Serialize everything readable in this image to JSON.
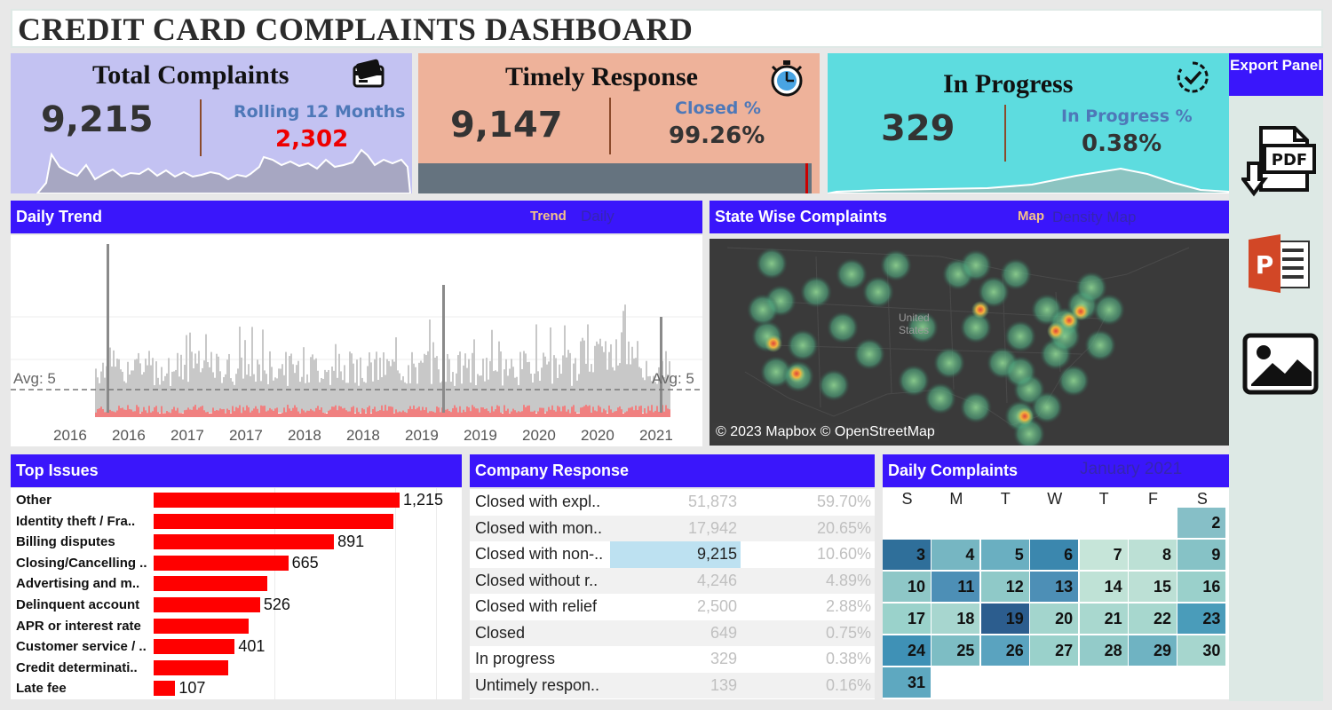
{
  "dashboard_title": "CREDIT CARD COMPLAINTS DASHBOARD",
  "kpi": {
    "total": {
      "title": "Total Complaints",
      "value": "9,215",
      "sub_label": "Rolling 12 Months",
      "sub_value": "2,302",
      "icon": "credit-card-icon"
    },
    "timely": {
      "title": "Timely Response",
      "value": "9,147",
      "sub_label": "Closed %",
      "sub_value": "99.26%",
      "icon": "stopwatch-icon",
      "progress": 0.9926
    },
    "progress": {
      "title": "In Progress",
      "value": "329",
      "sub_label": "In Progress %",
      "sub_value": "0.38%",
      "icon": "check-circle-icon"
    }
  },
  "export": {
    "label": "Export Panel",
    "items": [
      "pdf-icon",
      "powerpoint-icon",
      "image-icon"
    ]
  },
  "daily_trend": {
    "title": "Daily Trend",
    "toggle_active": "Trend",
    "toggle_inactive": "Daily",
    "avg_label_left": "Avg: 5",
    "avg_label_right": "Avg: 5",
    "x_ticks": [
      "2016",
      "2016",
      "2017",
      "2017",
      "2018",
      "2018",
      "2019",
      "2019",
      "2020",
      "2020",
      "2021"
    ]
  },
  "state_map": {
    "title": "State Wise Complaints",
    "toggle_active": "Map",
    "toggle_inactive": "Density Map",
    "map_label_line1": "United",
    "map_label_line2": "States",
    "attribution": "© 2023 Mapbox © OpenStreetMap"
  },
  "top_issues": {
    "title": "Top Issues",
    "items": [
      {
        "label": "Other",
        "value": 1215,
        "display": "1,215"
      },
      {
        "label": "Identity theft / Fra..",
        "value": 1185,
        "display": ""
      },
      {
        "label": "Billing disputes",
        "value": 891,
        "display": "891"
      },
      {
        "label": "Closing/Cancelling ..",
        "value": 665,
        "display": "665"
      },
      {
        "label": "Advertising and m..",
        "value": 560,
        "display": ""
      },
      {
        "label": "Delinquent account",
        "value": 526,
        "display": "526"
      },
      {
        "label": "APR or interest rate",
        "value": 470,
        "display": ""
      },
      {
        "label": "Customer service / ..",
        "value": 401,
        "display": "401"
      },
      {
        "label": "Credit determinati..",
        "value": 370,
        "display": ""
      },
      {
        "label": "Late fee",
        "value": 107,
        "display": "107"
      }
    ]
  },
  "company_response": {
    "title": "Company Response",
    "rows": [
      {
        "label": "Closed with expl..",
        "count": "51,873",
        "pct": "59.70%"
      },
      {
        "label": "Closed with mon..",
        "count": "17,942",
        "pct": "20.65%"
      },
      {
        "label": "Closed with non-..",
        "count": "9,215",
        "pct": "10.60%",
        "highlight": true
      },
      {
        "label": "Closed without r..",
        "count": "4,246",
        "pct": "4.89%"
      },
      {
        "label": "Closed with relief",
        "count": "2,500",
        "pct": "2.88%"
      },
      {
        "label": "Closed",
        "count": "649",
        "pct": "0.75%"
      },
      {
        "label": "In progress",
        "count": "329",
        "pct": "0.38%"
      },
      {
        "label": "Untimely respon..",
        "count": "139",
        "pct": "0.16%"
      }
    ]
  },
  "daily_complaints": {
    "title": "Daily Complaints",
    "month": "January 2021",
    "weekdays": [
      "S",
      "M",
      "T",
      "W",
      "T",
      "F",
      "S"
    ],
    "first_weekday": 6,
    "days": [
      {
        "d": "2",
        "c": "#86bfc7"
      },
      {
        "d": "3",
        "c": "#2f6f9a"
      },
      {
        "d": "4",
        "c": "#76b6c2"
      },
      {
        "d": "5",
        "c": "#6aafc1"
      },
      {
        "d": "6",
        "c": "#3b87ae"
      },
      {
        "d": "7",
        "c": "#c6e5d9"
      },
      {
        "d": "8",
        "c": "#bce0d5"
      },
      {
        "d": "9",
        "c": "#86c2c6"
      },
      {
        "d": "10",
        "c": "#8ec7c7"
      },
      {
        "d": "11",
        "c": "#4d8fb6"
      },
      {
        "d": "12",
        "c": "#8fc9c8"
      },
      {
        "d": "13",
        "c": "#4d8fb6"
      },
      {
        "d": "14",
        "c": "#bfe2d6"
      },
      {
        "d": "15",
        "c": "#bce0d5"
      },
      {
        "d": "16",
        "c": "#9ad0cb"
      },
      {
        "d": "17",
        "c": "#9ad2cb"
      },
      {
        "d": "18",
        "c": "#a7d6cf"
      },
      {
        "d": "19",
        "c": "#2c5d8e"
      },
      {
        "d": "20",
        "c": "#a3d5cd"
      },
      {
        "d": "21",
        "c": "#a9d8cf"
      },
      {
        "d": "22",
        "c": "#a7d7ce"
      },
      {
        "d": "23",
        "c": "#4a9cba"
      },
      {
        "d": "24",
        "c": "#3f91b6"
      },
      {
        "d": "25",
        "c": "#7dbdc4"
      },
      {
        "d": "26",
        "c": "#5aa3bf"
      },
      {
        "d": "27",
        "c": "#9ad1cb"
      },
      {
        "d": "28",
        "c": "#93cbc9"
      },
      {
        "d": "29",
        "c": "#6fb3c2"
      },
      {
        "d": "30",
        "c": "#a6d6ce"
      },
      {
        "d": "31",
        "c": "#5ea8c0"
      }
    ]
  },
  "colors": {
    "header_blue": "#3a16fb",
    "kpi1": "#c3c2f2",
    "kpi2": "#eeb29a",
    "kpi3": "#5ddcdf",
    "bar_red": "#ff0000",
    "accent_red": "#ee0000"
  }
}
